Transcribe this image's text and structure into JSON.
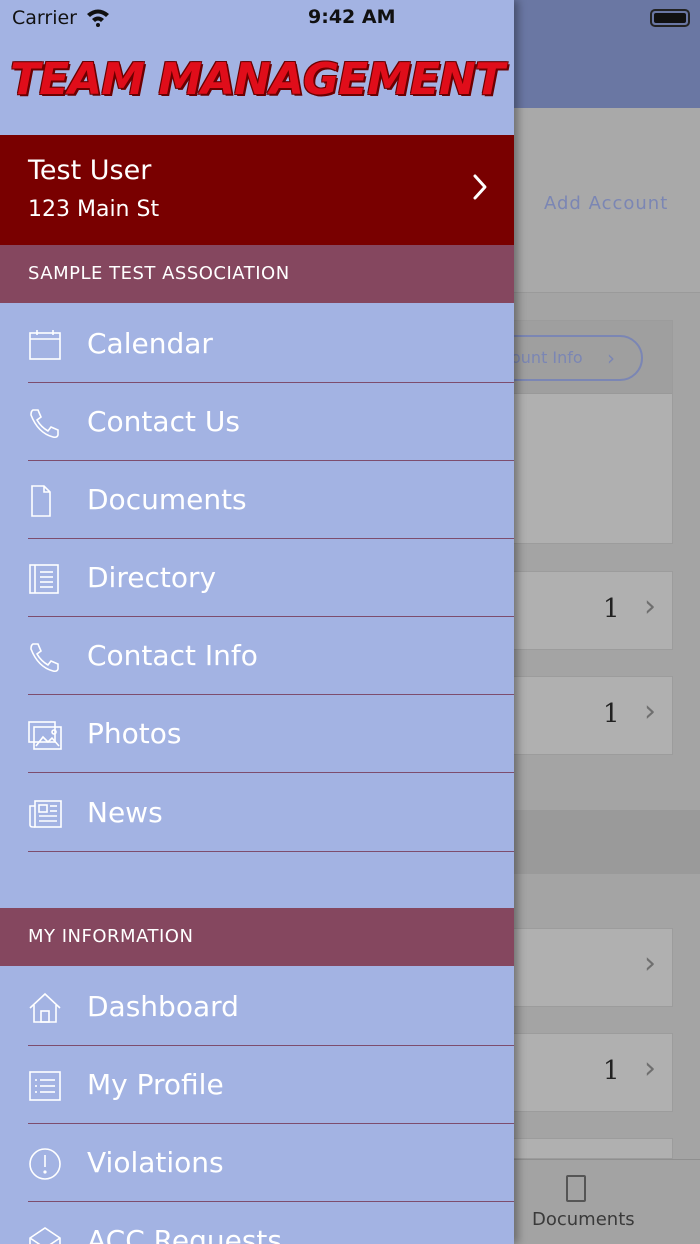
{
  "status_bar": {
    "carrier": "Carrier",
    "time": "9:42 AM"
  },
  "logo": {
    "text": "TEAM MANAGEMENT",
    "color": "#e00d1a"
  },
  "user": {
    "name": "Test User",
    "address": "123 Main St"
  },
  "sections": {
    "association": "SAMPLE TEST ASSOCIATION",
    "my_information": "MY INFORMATION"
  },
  "association_menu": [
    {
      "label": "Calendar",
      "icon": "calendar-icon"
    },
    {
      "label": "Contact Us",
      "icon": "phone-icon"
    },
    {
      "label": "Documents",
      "icon": "document-icon"
    },
    {
      "label": "Directory",
      "icon": "directory-icon"
    },
    {
      "label": "Contact Info",
      "icon": "phone-icon"
    },
    {
      "label": "Photos",
      "icon": "photos-icon"
    },
    {
      "label": "News",
      "icon": "news-icon"
    }
  ],
  "my_info_menu": [
    {
      "label": "Dashboard",
      "icon": "home-icon"
    },
    {
      "label": "My Profile",
      "icon": "list-icon"
    },
    {
      "label": "Violations",
      "icon": "alert-icon"
    },
    {
      "label": "ACC Requests",
      "icon": "envelope-icon"
    }
  ],
  "background": {
    "add_account": "Add Account",
    "account_info_button": "ount Info",
    "counts": [
      "1",
      "1",
      "1"
    ],
    "tab_documents": "Documents"
  },
  "colors": {
    "drawer_bg": "#a3b3e3",
    "user_banner": "#790000",
    "section_header": "#85475f",
    "header_bar": "#6a77a3"
  }
}
